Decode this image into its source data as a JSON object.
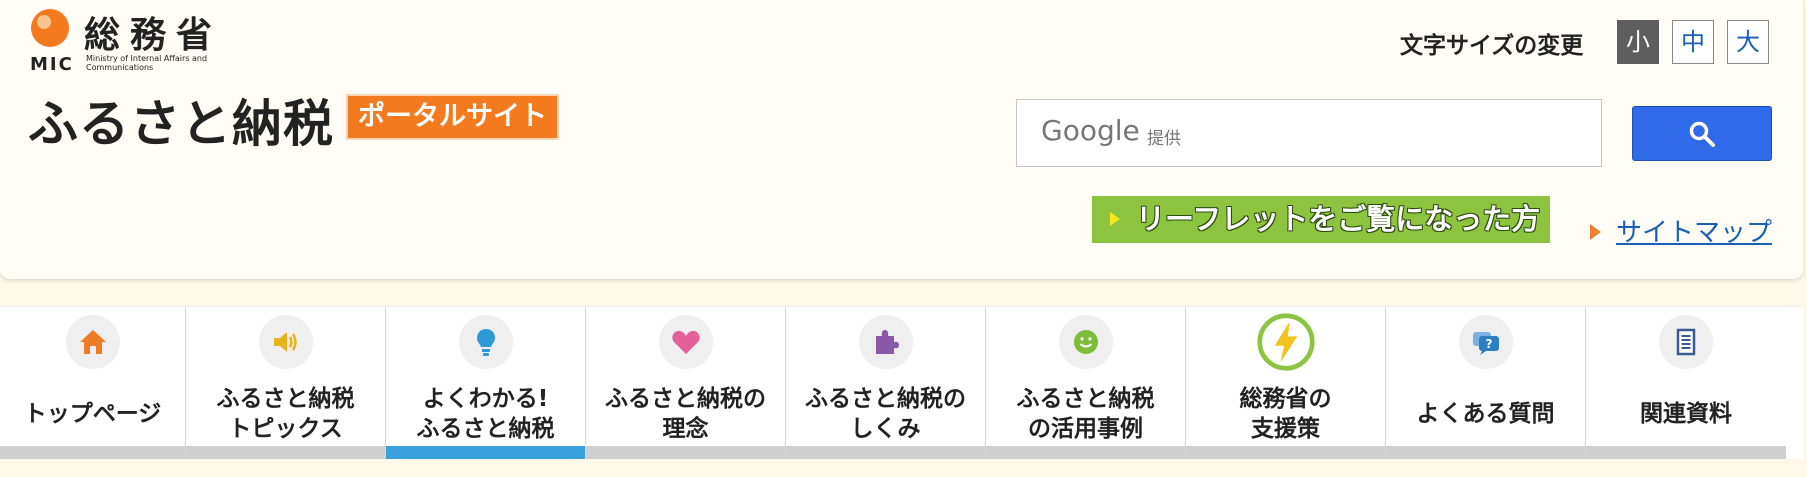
{
  "header": {
    "ministry_name": "総務省",
    "ministry_abbr": "MIC",
    "ministry_en": "Ministry of Internal Affairs and Communications",
    "site_title": "ふるさと納税",
    "portal_badge": "ポータルサイト",
    "fontsize_label": "文字サイズの変更",
    "fontsize_options": [
      "小",
      "中",
      "大"
    ],
    "fontsize_selected": "小",
    "search": {
      "google_label": "Google",
      "provided_label": "提供",
      "value": ""
    },
    "leaflet_banner": "リーフレットをご覧になった方",
    "sitemap_link": "サイトマップ"
  },
  "nav": {
    "items": [
      {
        "label": "トップページ",
        "icon": "home-icon",
        "icon_color": "#f07b26"
      },
      {
        "label": "ふるさと納税\nトピックス",
        "icon": "speaker-icon",
        "icon_color": "#e8b21d"
      },
      {
        "label": "よくわかる!\nふるさと納税",
        "icon": "lightbulb-icon",
        "icon_color": "#2d9ad8"
      },
      {
        "label": "ふるさと納税の\n理念",
        "icon": "heart-icon",
        "icon_color": "#e5609a"
      },
      {
        "label": "ふるさと納税の\nしくみ",
        "icon": "puzzle-icon",
        "icon_color": "#8a5aa8"
      },
      {
        "label": "ふるさと納税\nの活用事例",
        "icon": "smile-icon",
        "icon_color": "#7cbd3a"
      },
      {
        "label": "総務省の\n支援策",
        "icon": "lightning-icon",
        "icon_color": "#8cc43f"
      },
      {
        "label": "よくある質問",
        "icon": "question-bubble-icon",
        "icon_color": "#2d7fc1"
      },
      {
        "label": "関連資料",
        "icon": "document-icon",
        "icon_color": "#3b5a92"
      }
    ],
    "active_index": 2
  },
  "colors": {
    "accent_orange": "#f47a1f",
    "search_button": "#2f6be8",
    "leaflet_green": "#8cc43f",
    "active_tab": "#3aa0dc"
  }
}
